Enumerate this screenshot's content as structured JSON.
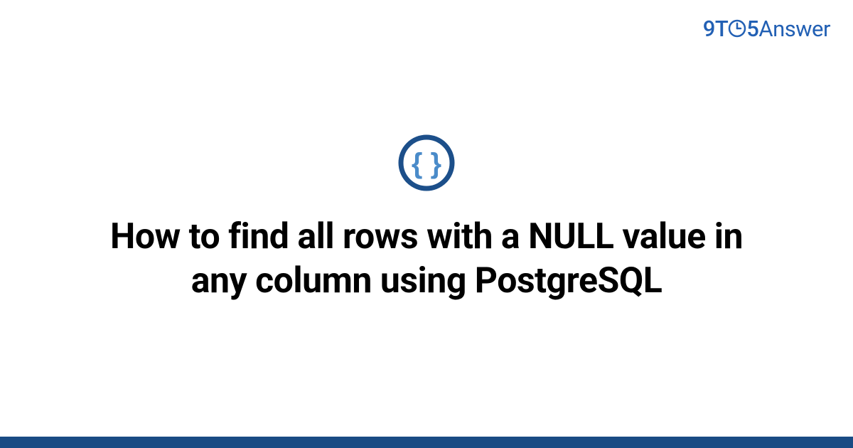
{
  "brand": {
    "prefix": "9T",
    "suffix": "5",
    "word": "Answer"
  },
  "main": {
    "title": "How to find all rows with a NULL value in any column using PostgreSQL"
  },
  "colors": {
    "brand": "#2260b4",
    "footer": "#194b84",
    "icon_ring": "#1c4f8a",
    "icon_braces": "#4a8bc9"
  }
}
